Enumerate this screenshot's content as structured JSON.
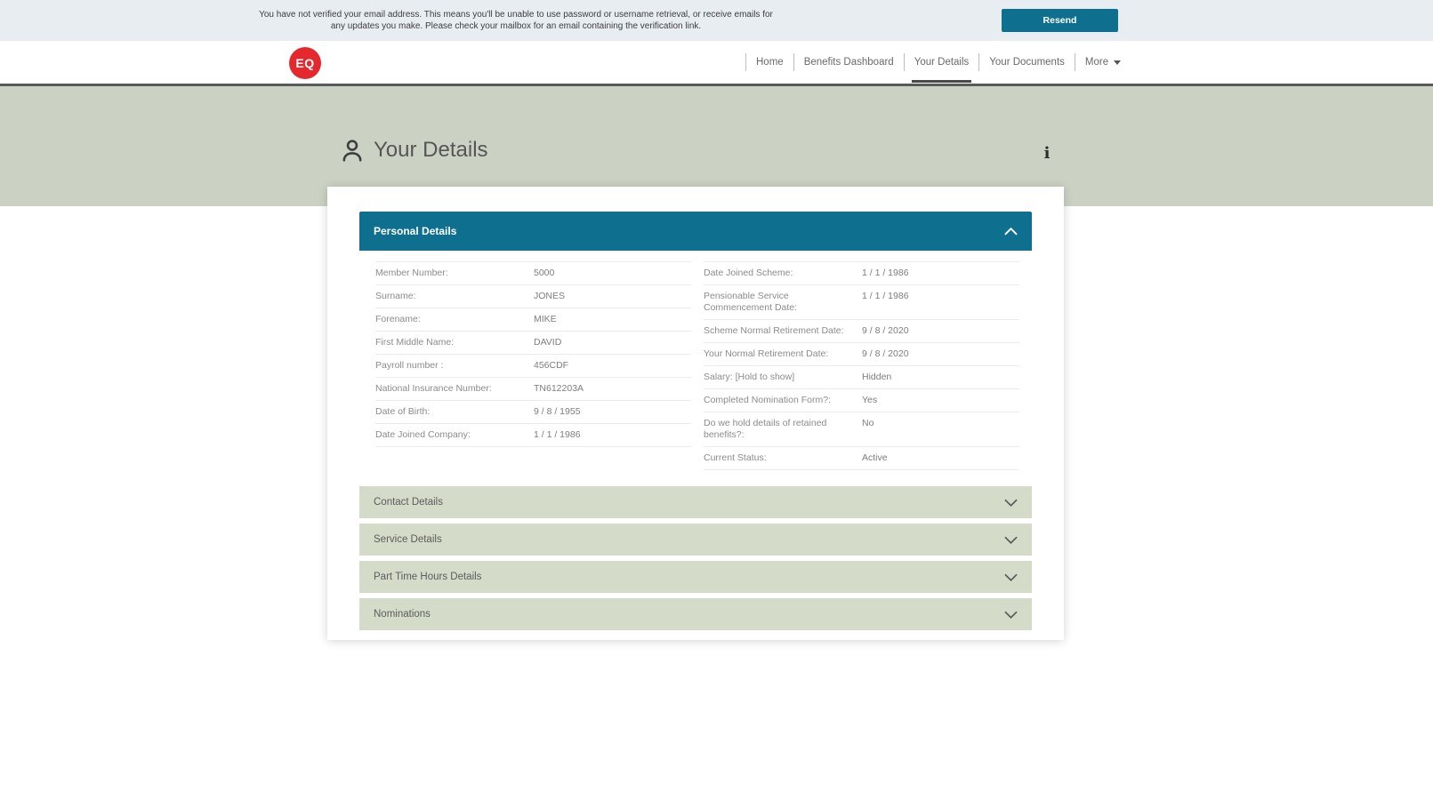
{
  "notification": {
    "message": "You have not verified your email address. This means you'll be unable to use password or username retrieval, or receive emails for any updates you make. Please check your mailbox for an email containing the verification link.",
    "resend_label": "Resend"
  },
  "header": {
    "logo_text": "EQ",
    "nav": [
      {
        "label": "Home"
      },
      {
        "label": "Benefits Dashboard"
      },
      {
        "label": "Your Details"
      },
      {
        "label": "Your Documents"
      },
      {
        "label": "More"
      }
    ],
    "active_tab": "Your Details"
  },
  "page": {
    "title": "Your Details",
    "info_icon_glyph": "i"
  },
  "personal_details": {
    "title": "Personal Details",
    "state": "expanded",
    "left_rows": [
      {
        "label": "Member Number:",
        "value": "5000"
      },
      {
        "label": "Surname:",
        "value": "JONES"
      },
      {
        "label": "Forename:",
        "value": "MIKE"
      },
      {
        "label": "First Middle Name:",
        "value": "DAVID"
      },
      {
        "label": "Payroll number :",
        "value": "456CDF"
      },
      {
        "label": "National Insurance Number:",
        "value": "TN612203A"
      },
      {
        "label": "Date of Birth:",
        "value": "9 / 8 / 1955"
      },
      {
        "label": "Date Joined Company:",
        "value": "1 / 1 / 1986"
      }
    ],
    "right_rows": [
      {
        "label": "Date Joined Scheme:",
        "value": "1 / 1 / 1986"
      },
      {
        "label": "Pensionable Service Commencement Date:",
        "value": "1 / 1 / 1986"
      },
      {
        "label": "Scheme Normal Retirement Date:",
        "value": "9 / 8 / 2020"
      },
      {
        "label": "Your Normal Retirement Date:",
        "value": "9 / 8 / 2020"
      },
      {
        "label": "Salary:  [Hold to show]",
        "value": "Hidden"
      },
      {
        "label": "Completed Nomination Form?:",
        "value": "Yes"
      },
      {
        "label": "Do we hold details of retained benefits?:",
        "value": "No"
      },
      {
        "label": "Current Status:",
        "value": "Active"
      }
    ]
  },
  "collapsed_sections": [
    {
      "title": "Contact Details"
    },
    {
      "title": "Service Details"
    },
    {
      "title": "Part Time Hours Details"
    },
    {
      "title": "Nominations"
    }
  ],
  "colors": {
    "accent_teal": "#0e6f8e",
    "brand_red": "#e4282d",
    "hero_band_green": "#cbd2c3",
    "section_green": "#d5dbc9",
    "notification_bg": "#e8edf2"
  }
}
